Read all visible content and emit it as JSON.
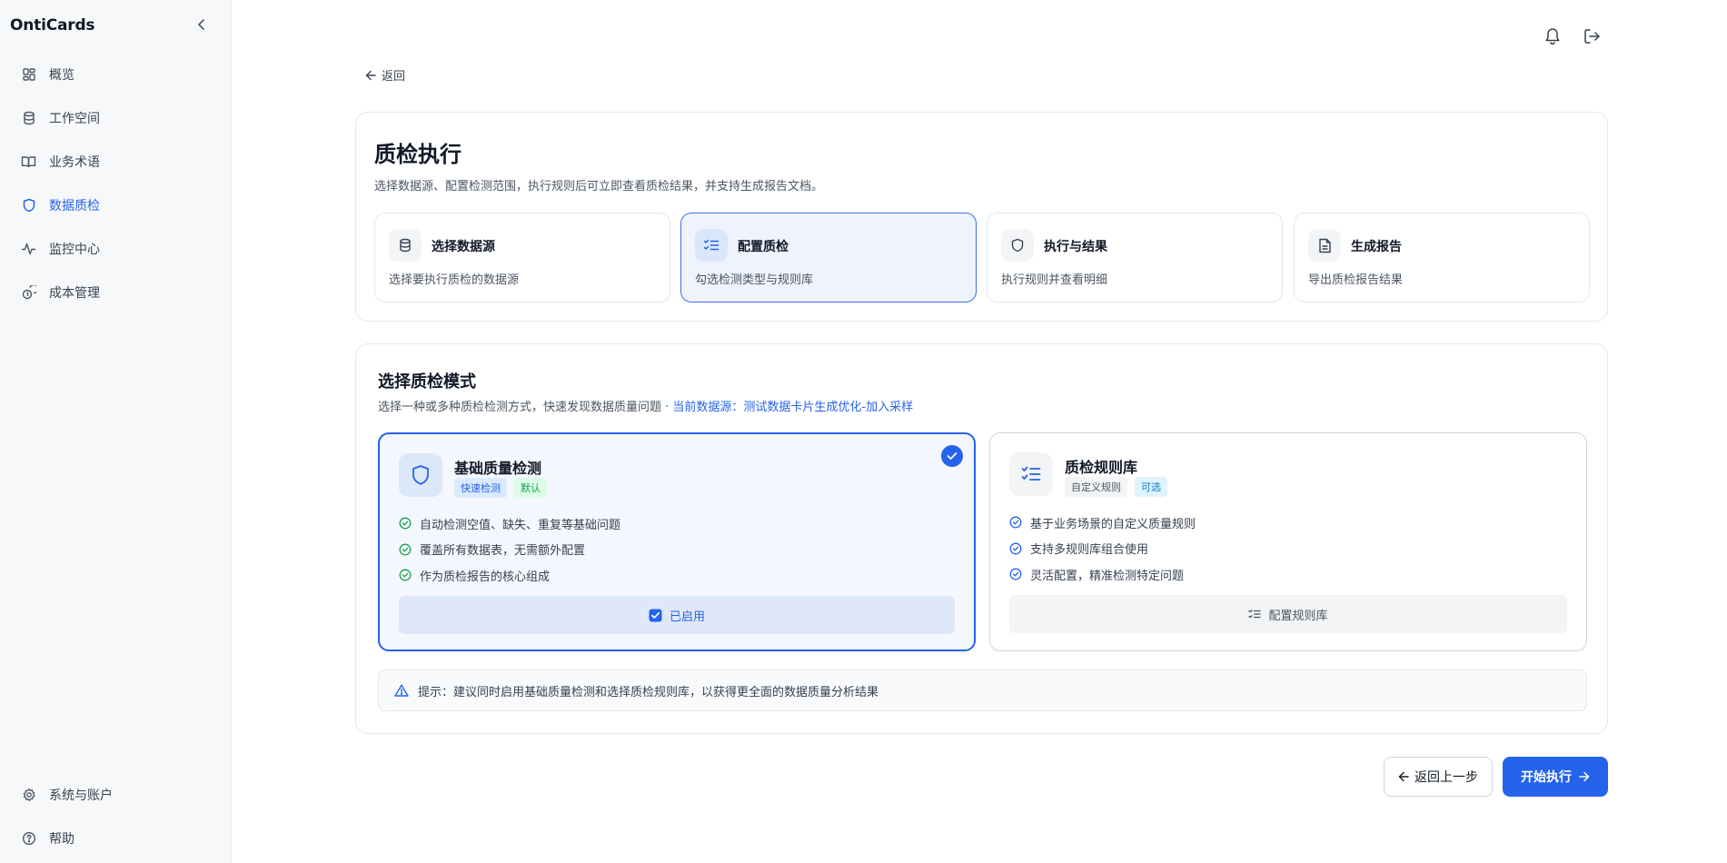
{
  "app": {
    "brand": "OntiCards"
  },
  "sidebar": {
    "items": [
      {
        "label": "概览",
        "icon": "grid-icon"
      },
      {
        "label": "工作空间",
        "icon": "database-icon"
      },
      {
        "label": "业务术语",
        "icon": "book-icon"
      },
      {
        "label": "数据质检",
        "icon": "shield-icon",
        "active": true
      },
      {
        "label": "监控中心",
        "icon": "activity-icon"
      },
      {
        "label": "成本管理",
        "icon": "coins-icon"
      }
    ],
    "bottom": [
      {
        "label": "系统与账户",
        "icon": "gear-icon"
      },
      {
        "label": "帮助",
        "icon": "help-icon"
      }
    ]
  },
  "topbar": {
    "icons": [
      "bell-icon",
      "logout-icon"
    ]
  },
  "back": {
    "label": "返回"
  },
  "header": {
    "title": "质检执行",
    "description": "选择数据源、配置检测范围，执行规则后可立即查看质检结果，并支持生成报告文档。",
    "steps": [
      {
        "title": "选择数据源",
        "desc": "选择要执行质检的数据源",
        "icon": "database-icon"
      },
      {
        "title": "配置质检",
        "desc": "勾选检测类型与规则库",
        "icon": "checklist-icon",
        "active": true
      },
      {
        "title": "执行与结果",
        "desc": "执行规则并查看明细",
        "icon": "shield-icon"
      },
      {
        "title": "生成报告",
        "desc": "导出质检报告结果",
        "icon": "document-icon"
      }
    ]
  },
  "mode_section": {
    "title": "选择质检模式",
    "description": "选择一种或多种质检检测方式，快速发现数据质量问题",
    "source_prefix": " · 当前数据源：",
    "source_name": "测试数据卡片生成优化-加入采样",
    "modes": [
      {
        "title": "基础质量检测",
        "icon": "shield-icon",
        "tags": [
          "快速检测",
          "默认"
        ],
        "features": [
          "自动检测空值、缺失、重复等基础问题",
          "覆盖所有数据表，无需额外配置",
          "作为质检报告的核心组成"
        ],
        "button": "已启用",
        "selected": true
      },
      {
        "title": "质检规则库",
        "icon": "checklist-icon",
        "tags": [
          "自定义规则",
          "可选"
        ],
        "features": [
          "基于业务场景的自定义质量规则",
          "支持多规则库组合使用",
          "灵活配置，精准检测特定问题"
        ],
        "button": "配置规则库",
        "selected": false
      }
    ],
    "tip": "提示：建议同时启用基础质量检测和选择质检规则库，以获得更全面的数据质量分析结果"
  },
  "footer": {
    "prev": "返回上一步",
    "start": "开始执行"
  },
  "colors": {
    "accent": "#2563eb",
    "success": "#16a34a",
    "sidebar_bg": "#f7f8fa"
  }
}
